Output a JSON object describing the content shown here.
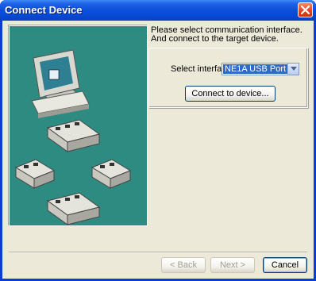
{
  "window": {
    "title": "Connect Device"
  },
  "prompt": {
    "line1": "Please select communication interface.",
    "line2": "And connect to the target device."
  },
  "interface": {
    "label": "Select interface:",
    "value": "NE1A USB Port"
  },
  "buttons": {
    "connect": "Connect to device...",
    "back": "< Back",
    "next": "Next >",
    "cancel": "Cancel"
  },
  "colors": {
    "illustration_bg": "#2e8b82",
    "titlebar": "#0a4fdc",
    "dialog_bg": "#ece9d8"
  },
  "icons": [
    "close-icon",
    "computer-icon",
    "controller-device-icon",
    "dropdown-arrow-icon"
  ]
}
